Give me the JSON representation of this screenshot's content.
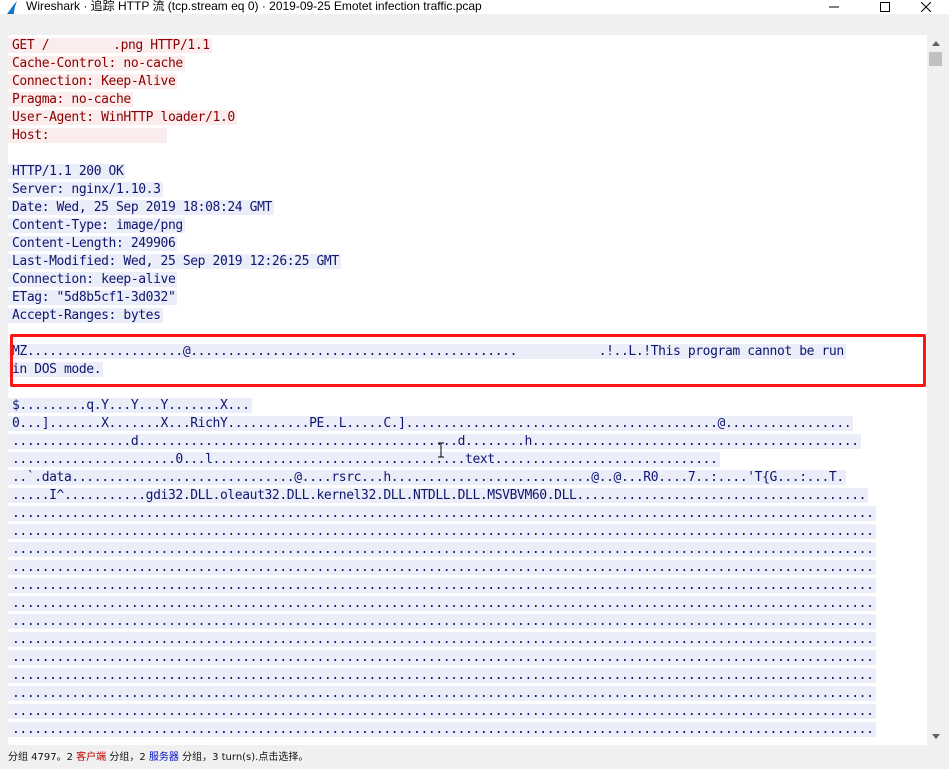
{
  "window": {
    "title": "Wireshark · 追踪 HTTP 流 (tcp.stream eq 0) · 2019-09-25 Emotet infection traffic.pcap"
  },
  "stream": {
    "request_lines": [
      "GET /",
      ".png HTTP/1.1",
      "Cache-Control: no-cache",
      "Connection: Keep-Alive",
      "Pragma: no-cache",
      "User-Agent: WinHTTP loader/1.0",
      "Host: "
    ],
    "response_lines": [
      "HTTP/1.1 200 OK",
      "Server: nginx/1.10.3",
      "Date: Wed, 25 Sep 2019 18:08:24 GMT",
      "Content-Type: image/png",
      "Content-Length: 249906",
      "Last-Modified: Wed, 25 Sep 2019 12:26:25 GMT",
      "Connection: keep-alive",
      "ETag: \"5d8b5cf1-3d032\"",
      "Accept-Ranges: bytes"
    ],
    "body_lines": [
      "MZ.....................@............................................           .!..L.!This program cannot be run",
      "in DOS mode.",
      "",
      "$.........q.Y...Y...Y.......X...",
      "0...].......X.......X...RichY...........PE..L.....C.]..........................................@.................",
      "................d...........................................d........h............................................",
      "......................0...l..................................text..............................",
      "..`.data..............................@....rsrc...h...........................@..@...R0....7..:....'T{G...:...T.",
      ".....I^...........gdi32.DLL.oleaut32.DLL.kernel32.DLL.NTDLL.DLL.MSVBVM60.DLL.......................................",
      "....................................................................................................................",
      "....................................................................................................................",
      "....................................................................................................................",
      "....................................................................................................................",
      "....................................................................................................................",
      "....................................................................................................................",
      "....................................................................................................................",
      "....................................................................................................................",
      "....................................................................................................................",
      "....................................................................................................................",
      "....................................................................................................................",
      "....................................................................................................................",
      "...................................................................................................................."
    ]
  },
  "status": {
    "prefix": "分组 4797。2 ",
    "client_word": "客户端",
    "middle": " 分组，2 ",
    "server_word": "服务器",
    "suffix": " 分组，3 turn(s).点击选择。"
  },
  "colors": {
    "client_bg": "#fbeded",
    "client_fg": "#8b0000",
    "server_bg": "#ebedf9",
    "server_fg": "#0e1670",
    "highlight_box": "#ff1414"
  }
}
